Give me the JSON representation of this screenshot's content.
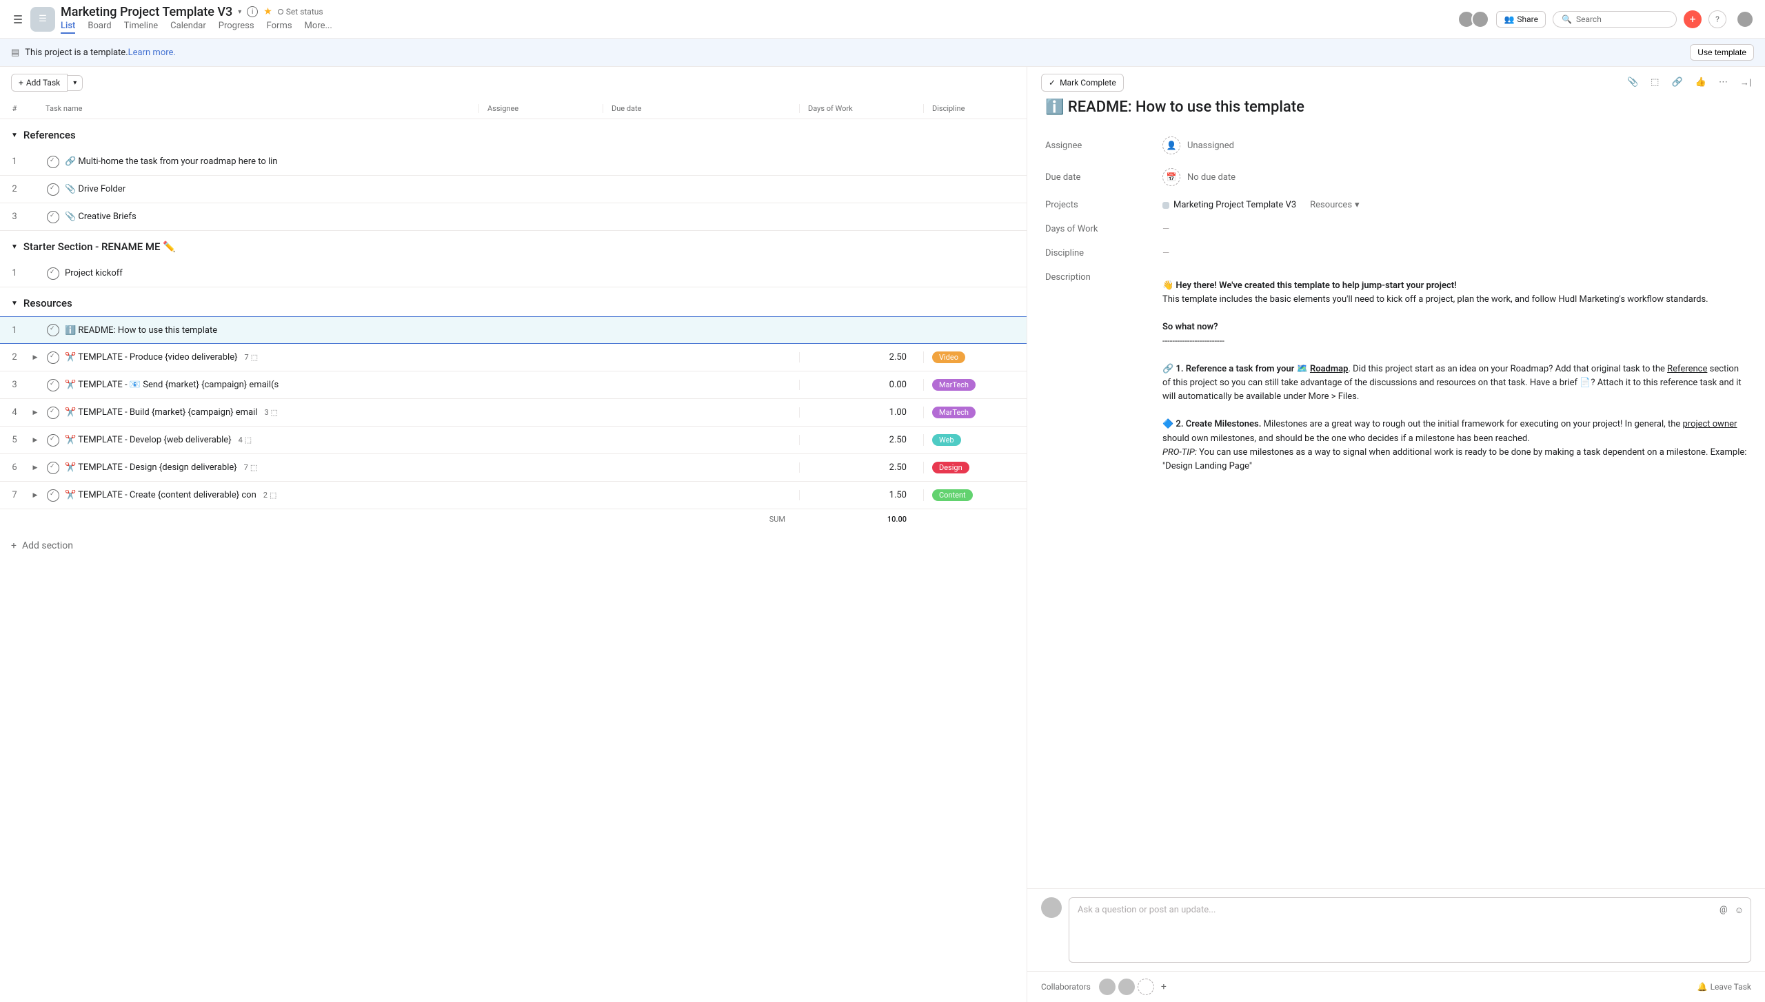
{
  "header": {
    "title": "Marketing Project Template V3",
    "set_status": "Set status",
    "share": "Share",
    "search_placeholder": "Search",
    "tabs": [
      "List",
      "Board",
      "Timeline",
      "Calendar",
      "Progress",
      "Forms",
      "More..."
    ]
  },
  "banner": {
    "text": "This project is a template. ",
    "link": "Learn more.",
    "button": "Use template"
  },
  "toolbar": {
    "add_task": "Add Task",
    "add_section": "Add section"
  },
  "columns": {
    "num": "#",
    "name": "Task name",
    "assignee": "Assignee",
    "date": "Due date",
    "days": "Days of Work",
    "discipline": "Discipline"
  },
  "sections": [
    {
      "name": "References",
      "tasks": [
        {
          "n": "1",
          "name": "🔗 Multi-home the task from your roadmap here to lin"
        },
        {
          "n": "2",
          "name": "📎 Drive Folder"
        },
        {
          "n": "3",
          "name": "📎 Creative Briefs"
        }
      ]
    },
    {
      "name": "Starter Section - RENAME ME ✏️",
      "tasks": [
        {
          "n": "1",
          "name": "Project kickoff"
        }
      ]
    },
    {
      "name": "Resources",
      "tasks": [
        {
          "n": "1",
          "name": "ℹ️ README: How to use this template",
          "selected": true
        },
        {
          "n": "2",
          "name": "✂️ TEMPLATE - Produce {video deliverable}",
          "sub": "7",
          "days": "2.50",
          "disc": "Video",
          "expand": true
        },
        {
          "n": "3",
          "name": "✂️ TEMPLATE - 📧 Send {market} {campaign} email(s",
          "days": "0.00",
          "disc": "MarTech"
        },
        {
          "n": "4",
          "name": "✂️ TEMPLATE - Build {market} {campaign} email",
          "sub": "3",
          "days": "1.00",
          "disc": "MarTech",
          "expand": true
        },
        {
          "n": "5",
          "name": "✂️ TEMPLATE - Develop {web deliverable}",
          "sub": "4",
          "days": "2.50",
          "disc": "Web",
          "expand": true
        },
        {
          "n": "6",
          "name": "✂️ TEMPLATE - Design {design deliverable}",
          "sub": "7",
          "days": "2.50",
          "disc": "Design",
          "expand": true
        },
        {
          "n": "7",
          "name": "✂️ TEMPLATE - Create {content deliverable} con",
          "sub": "2",
          "days": "1.50",
          "disc": "Content",
          "expand": true
        }
      ]
    }
  ],
  "sum": {
    "label": "SUM",
    "value": "10.00"
  },
  "detail": {
    "mark_complete": "Mark Complete",
    "title": "ℹ️ README: How to use this template",
    "fields": {
      "assignee_label": "Assignee",
      "assignee_val": "Unassigned",
      "due_label": "Due date",
      "due_val": "No due date",
      "projects_label": "Projects",
      "projects_val": "Marketing Project Template V3",
      "projects_section": "Resources",
      "days_label": "Days of Work",
      "discipline_label": "Discipline",
      "description_label": "Description"
    },
    "desc": {
      "line1a": "👋 ",
      "line1b": "Hey there!  We've created this template to help jump-start your project!",
      "line2": "This template includes the basic elements you'll need to kick off a project, plan the work, and follow Hudl Marketing's workflow standards.",
      "line3": "So what now?",
      "line4": "-------------------------",
      "p1a": "🔗 ",
      "p1b": "1. Reference a task from your 🗺️ ",
      "p1c": "Roadmap",
      "p1d": ". Did this project start as an idea on your Roadmap? Add that original task to the ",
      "p1e": "Reference",
      "p1f": " section of this project so you can still take advantage of the discussions and resources on that task.  Have a brief 📄?  Attach it to this reference task and it will automatically be available under More > Files.",
      "p2a": "🔷 ",
      "p2b": "2. Create Milestones.",
      "p2c": " Milestones are a great way to rough out the initial framework for executing on your project! In general, the ",
      "p2d": "project owner",
      "p2e": " should own milestones, and should be the one who decides if a milestone has been reached.",
      "p3a": "PRO-TIP:",
      "p3b": " You can use milestones as a way to signal when additional work is ready to be done by making a task dependent on a milestone. Example: \"Design Landing Page\""
    },
    "comment_placeholder": "Ask a question or post an update...",
    "collaborators": "Collaborators",
    "leave": "Leave Task"
  }
}
